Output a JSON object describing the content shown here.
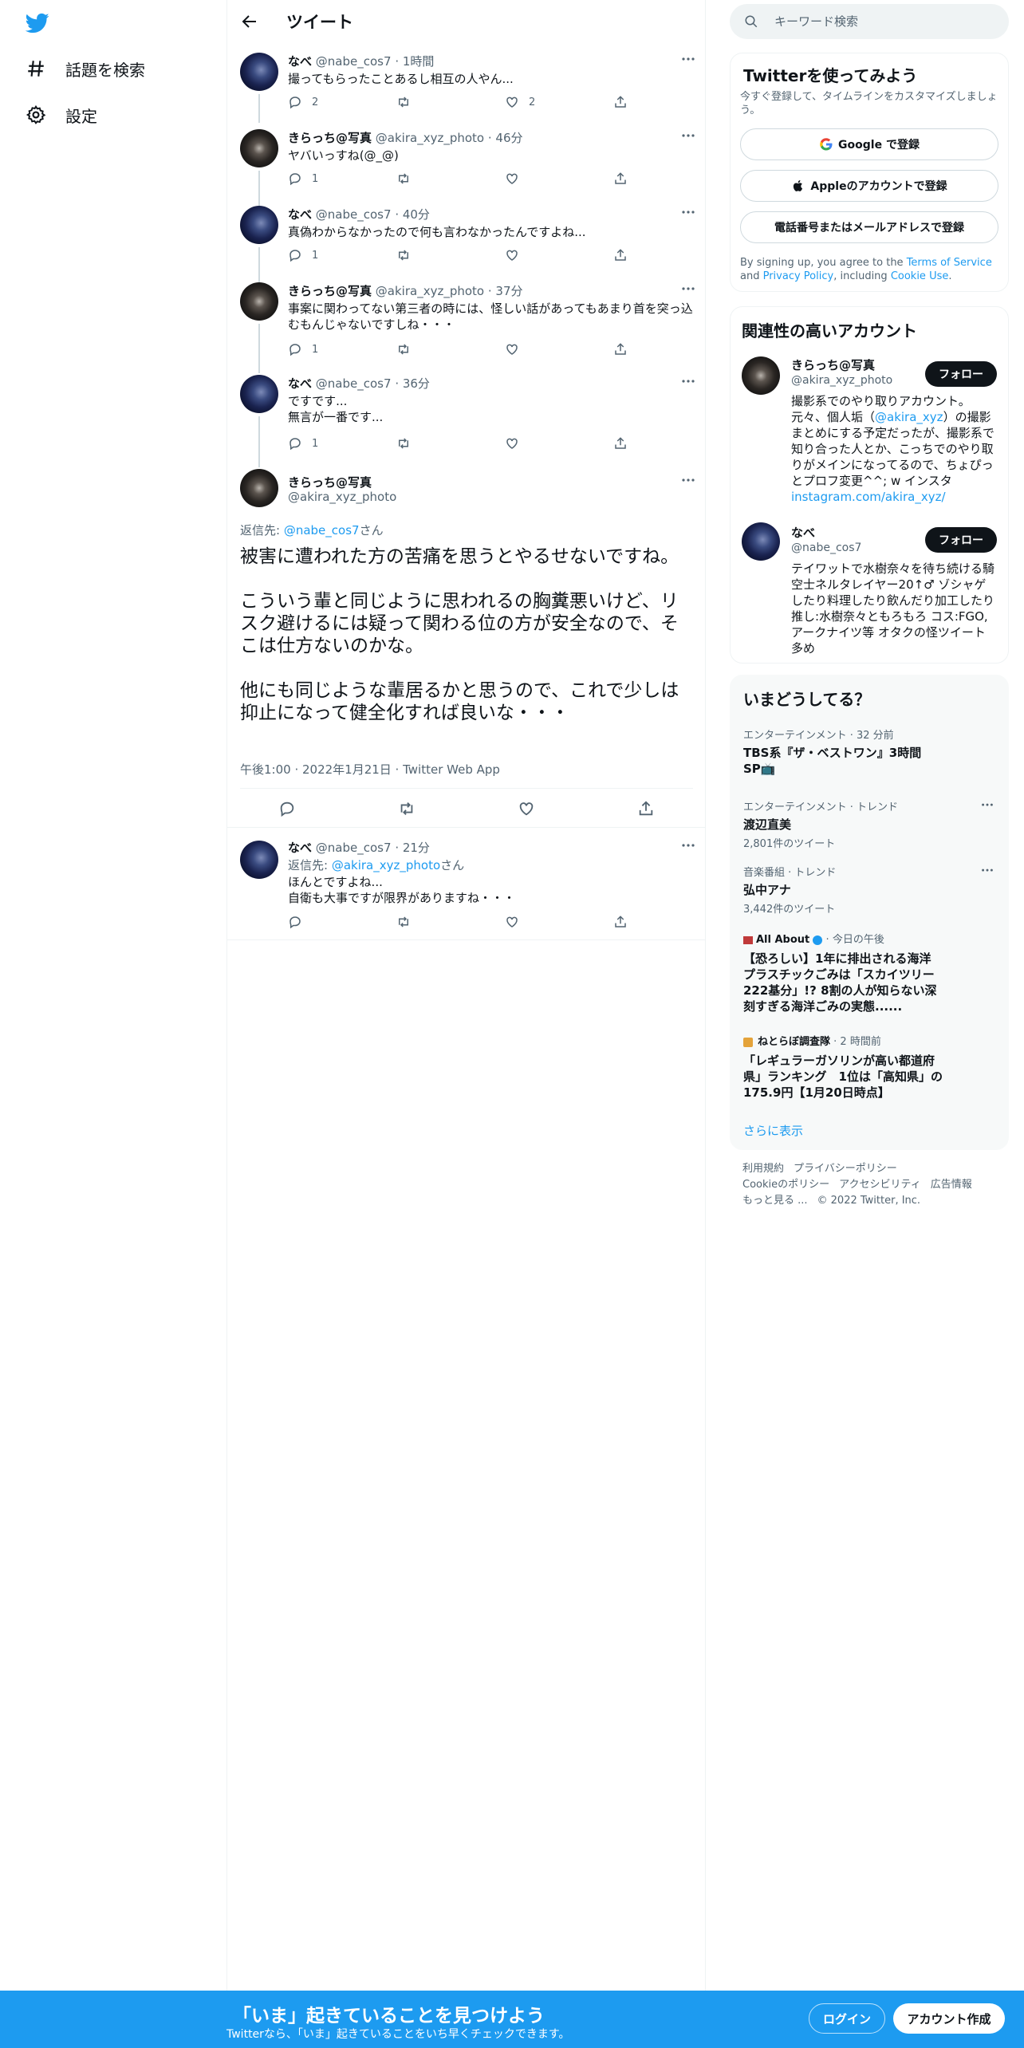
{
  "colors": {
    "accent": "#1d9bf0",
    "text": "#0f1419",
    "secondary": "#536471"
  },
  "nav": {
    "logo_icon": "twitter-bird-icon",
    "items": [
      {
        "label": "話題を検索",
        "icon": "hashtag-icon"
      },
      {
        "label": "設定",
        "icon": "gear-icon"
      }
    ]
  },
  "header": {
    "title": "ツイート",
    "back_icon": "arrow-left-icon"
  },
  "thread": [
    {
      "name": "なべ",
      "handle": "@nabe_cos7",
      "time": "· 1時間",
      "text": "撮ってもらったことあるし相互の人やん...",
      "reply_count": "2",
      "retweet_count": "",
      "like_count": "2"
    },
    {
      "name": "きらっち@写真",
      "handle": "@akira_xyz_photo",
      "time": "· 46分",
      "text": "ヤバいっすね(@_@)",
      "reply_count": "1",
      "retweet_count": "",
      "like_count": ""
    },
    {
      "name": "なべ",
      "handle": "@nabe_cos7",
      "time": "· 40分",
      "text": "真偽わからなかったので何も言わなかったんですよね...",
      "reply_count": "1",
      "retweet_count": "",
      "like_count": ""
    },
    {
      "name": "きらっち@写真",
      "handle": "@akira_xyz_photo",
      "time": "· 37分",
      "text": "事案に関わってない第三者の時には、怪しい話があってもあまり首を突っ込むもんじゃないですしね・・・",
      "reply_count": "1",
      "retweet_count": "",
      "like_count": ""
    },
    {
      "name": "なべ",
      "handle": "@nabe_cos7",
      "time": "· 36分",
      "text": "ですです...\n無言が一番です...",
      "reply_count": "1",
      "retweet_count": "",
      "like_count": ""
    }
  ],
  "focus": {
    "name": "きらっち@写真",
    "handle": "@akira_xyz_photo",
    "reply_prefix": "返信先: ",
    "reply_handle": "@nabe_cos7",
    "reply_suffix": "さん",
    "text": "被害に遭われた方の苦痛を思うとやるせないですね。\n\nこういう輩と同じように思われるの胸糞悪いけど、リスク避けるには疑って関わる位の方が安全なので、そこは仕方ないのかな。\n\n他にも同じような輩居るかと思うので、これで少しは抑止になって健全化すれば良いな・・・",
    "timestamp": "午後1:00 · 2022年1月21日 · Twitter Web App"
  },
  "reply": {
    "name": "なべ",
    "handle": "@nabe_cos7",
    "time": "· 21分",
    "reply_prefix": "返信先: ",
    "reply_handle": "@akira_xyz_photo",
    "reply_suffix": "さん",
    "text": "ほんとですよね...\n自衛も大事ですが限界がありますね・・・"
  },
  "search": {
    "placeholder": "キーワード検索"
  },
  "signup": {
    "title": "Twitterを使ってみよう",
    "subtitle": "今すぐ登録して、タイムラインをカスタマイズしましょう。",
    "google": "Google で登録",
    "apple": "Appleのアカウントで登録",
    "phone": "電話番号またはメールアドレスで登録",
    "legal_1": "By signing up, you agree to the ",
    "terms": "Terms of Service",
    "legal_2": " and ",
    "privacy": "Privacy Policy",
    "legal_3": ", including ",
    "cookie": "Cookie Use",
    "legal_4": "."
  },
  "relevant": {
    "title": "関連性の高いアカウント",
    "follow_label": "フォロー",
    "accounts": [
      {
        "name": "きらっち@写真",
        "handle": "@akira_xyz_photo",
        "bio_1": "撮影系でのやり取りアカウント。\n元々、個人垢（",
        "bio_link": "@akira_xyz",
        "bio_2": "）の撮影まとめにする予定だったが、撮影系で知り合った人とか、こっちでのやり取りがメインになってるので、ちょぴっとプロフ変更^^; w インスタ",
        "bio_url": "instagram.com/akira_xyz/"
      },
      {
        "name": "なべ",
        "handle": "@nabe_cos7",
        "bio": "テイワットで水樹奈々を待ち続ける騎空士ネルタレイヤー20↑♂ ゾシャゲしたり料理したり飲んだり加工したり推し:水樹奈々ともろもろ コス:FGO,アークナイツ等 オタクの怪ツイート多め"
      }
    ]
  },
  "trends": {
    "title": "いまどうしてる？",
    "items": [
      {
        "meta": "エンターテインメント · 32 分前",
        "title": "TBS系『ザ・ベストワン』3時間SP📺",
        "count": ""
      },
      {
        "meta": "エンターテインメント · トレンド",
        "title": "渡辺直美",
        "count": "2,801件のツイート"
      },
      {
        "meta": "音楽番組 · トレンド",
        "title": "弘中アナ",
        "count": "3,442件のツイート"
      },
      {
        "source": "All About",
        "meta": " · 今日の午後",
        "title": "【恐ろしい】1年に排出される海洋プラスチックごみは「スカイツリー222基分」!? 8割の人が知らない深刻すぎる海洋ごみの実態......"
      },
      {
        "source": "ねとらぼ調査隊",
        "meta": " · 2 時間前",
        "title": "「レギュラーガソリンが高い都道府県」ランキング　1位は「高知県」の175.9円【1月20日時点】"
      }
    ],
    "show_more": "さらに表示"
  },
  "footer": {
    "links": [
      "利用規約",
      "プライバシーポリシー",
      "Cookieのポリシー",
      "アクセシビリティ",
      "広告情報",
      "もっと見る ..."
    ],
    "copyright": "© 2022 Twitter, Inc."
  },
  "bottom_bar": {
    "title": "「いま」起きていることを見つけよう",
    "subtitle": "Twitterなら、「いま」起きていることをいち早くチェックできます。",
    "login": "ログイン",
    "signup": "アカウント作成"
  }
}
